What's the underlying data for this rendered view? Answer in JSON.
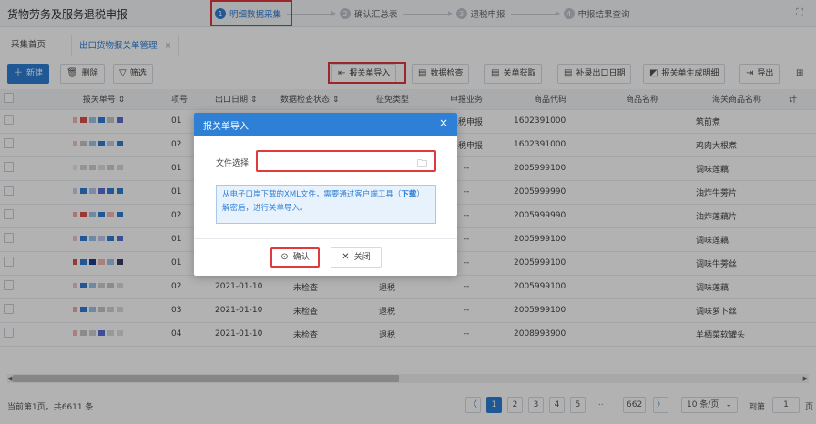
{
  "app": {
    "title": "货物劳务及服务退税申报"
  },
  "steps": [
    {
      "num": "1",
      "label": "明细数据采集",
      "active": true
    },
    {
      "num": "2",
      "label": "确认汇总表"
    },
    {
      "num": "3",
      "label": "退税申报"
    },
    {
      "num": "4",
      "label": "申报结果查询"
    }
  ],
  "tabs": {
    "home": "采集首页",
    "current": "出口货物报关单管理",
    "close": "×"
  },
  "toolbar": {
    "new": "新建",
    "delete": "删除",
    "filter": "筛选",
    "import": "报关单导入",
    "check": "数据检查",
    "fetch": "关单获取",
    "supplement": "补录出口日期",
    "generate": "报关单生成明细",
    "export": "导出"
  },
  "table": {
    "headers": [
      "",
      "报关单号 ⇕",
      "项号",
      "出口日期 ⇕",
      "数据检查状态 ⇕",
      "征免类型",
      "申报业务",
      "商品代码",
      "商品名称",
      "海关商品名称",
      "计"
    ],
    "rows": [
      {
        "item": "01",
        "date": "",
        "status": "",
        "type": "",
        "biz": "退税申报",
        "code": "1602391000",
        "hs_name": "筑前煮"
      },
      {
        "item": "02",
        "date": "",
        "status": "",
        "type": "",
        "biz": "退税申报",
        "code": "1602391000",
        "hs_name": "鸡肉大根煮"
      },
      {
        "item": "01",
        "date": "",
        "status": "",
        "type": "",
        "biz": "--",
        "code": "2005999100",
        "hs_name": "调味莲藕"
      },
      {
        "item": "01",
        "date": "",
        "status": "",
        "type": "",
        "biz": "--",
        "code": "2005999990",
        "hs_name": "油炸牛蒡片"
      },
      {
        "item": "02",
        "date": "",
        "status": "",
        "type": "",
        "biz": "--",
        "code": "2005999990",
        "hs_name": "油炸莲藕片"
      },
      {
        "item": "01",
        "date": "",
        "status": "",
        "type": "",
        "biz": "--",
        "code": "2005999100",
        "hs_name": "调味莲藕"
      },
      {
        "item": "01",
        "date": "",
        "status": "",
        "type": "",
        "biz": "--",
        "code": "2005999100",
        "hs_name": "调味牛蒡丝"
      },
      {
        "item": "02",
        "date": "2021-01-10",
        "status": "未检查",
        "type": "退税",
        "biz": "--",
        "code": "2005999100",
        "hs_name": "调味莲藕"
      },
      {
        "item": "03",
        "date": "2021-01-10",
        "status": "未检查",
        "type": "退税",
        "biz": "--",
        "code": "2005999100",
        "hs_name": "调味萝卜丝"
      },
      {
        "item": "04",
        "date": "2021-01-10",
        "status": "未检查",
        "type": "退税",
        "biz": "--",
        "code": "2008993900",
        "hs_name": "羊栖菜软罐头"
      }
    ]
  },
  "footer": {
    "info": "当前第1页，共6611 条",
    "pages": [
      "1",
      "2",
      "3",
      "4",
      "5"
    ],
    "dots": "...",
    "last": "662",
    "page_size": "10 条/页",
    "goto_label": "到第",
    "goto_value": "1",
    "goto_unit": "页"
  },
  "modal": {
    "title": "报关单导入",
    "file_label": "文件选择",
    "notice_1": "从电子口岸下载的XML文件，需要通过客户端工具（",
    "notice_link": "下载",
    "notice_2": "）",
    "notice_3": "解密后，进行关单导入。",
    "confirm": "确认",
    "close": "关闭"
  },
  "colors": {
    "accent": "#2e7fd6",
    "highlight": "#e0393e"
  }
}
